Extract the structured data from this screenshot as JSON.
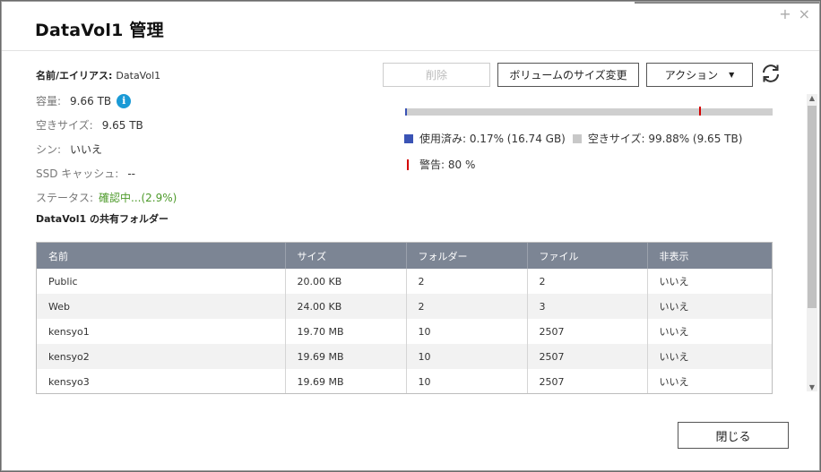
{
  "window": {
    "title": "DataVol1  管理",
    "plus_glyph": "+",
    "close_glyph": "×"
  },
  "info": {
    "name_label": "名前/エイリアス:",
    "name_value": "DataVol1",
    "capacity_label": "容量:",
    "capacity_value": "9.66 TB",
    "info_glyph": "i",
    "free_label": "空きサイズ:",
    "free_value": "9.65 TB",
    "thin_label": "シン:",
    "thin_value": "いいえ",
    "ssd_label": "SSD キャッシュ:",
    "ssd_value": "--",
    "status_label": "ステータス:",
    "status_value": "確認中...(2.9%)"
  },
  "toolbar": {
    "delete_label": "削除",
    "resize_label": "ボリュームのサイズ変更",
    "action_label": "アクション",
    "action_caret": "▼"
  },
  "usage": {
    "used_fraction": 0.0017,
    "warning_fraction": 0.8,
    "used_color": "#3a53b5",
    "free_color": "#c8c8c8",
    "warning_color": "#d40000",
    "used_legend": "使用済み: 0.17% (16.74 GB)",
    "free_legend": "空きサイズ: 99.88% (9.65 TB)",
    "warning_legend": "警告: 80 %"
  },
  "shared_folders": {
    "heading": "DataVol1 の共有フォルダー",
    "columns": [
      "名前",
      "サイズ",
      "フォルダー",
      "ファイル",
      "非表示"
    ],
    "rows": [
      [
        "Public",
        "20.00 KB",
        "2",
        "2",
        "いいえ"
      ],
      [
        "Web",
        "24.00 KB",
        "2",
        "3",
        "いいえ"
      ],
      [
        "kensyo1",
        "19.70 MB",
        "10",
        "2507",
        "いいえ"
      ],
      [
        "kensyo2",
        "19.69 MB",
        "10",
        "2507",
        "いいえ"
      ],
      [
        "kensyo3",
        "19.69 MB",
        "10",
        "2507",
        "いいえ"
      ]
    ]
  },
  "footer": {
    "close_label": "閉じる"
  }
}
